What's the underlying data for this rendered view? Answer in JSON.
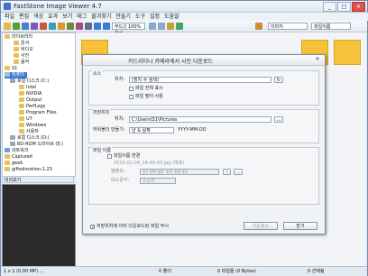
{
  "window": {
    "title": "FastStone Image Viewer 4.7",
    "min": "_",
    "max": "□",
    "close": "✕"
  },
  "menu": [
    "파일",
    "편집",
    "색상",
    "효과",
    "보기",
    "태그",
    "즐겨찾기",
    "만들기",
    "도구",
    "설정",
    "도움말"
  ],
  "toolbar": {
    "zoom": "100%",
    "view_label": "부드럽게",
    "sort_label": "이미지",
    "order_label": "파일이름"
  },
  "tree": [
    {
      "label": "라이브러리"
    },
    {
      "label": "문서"
    },
    {
      "label": "비디오"
    },
    {
      "label": "사진"
    },
    {
      "label": "음악"
    },
    {
      "label": "S1"
    },
    {
      "label": "컴퓨터"
    },
    {
      "label": "로컬 디스크 (C:)"
    },
    {
      "label": "Intel"
    },
    {
      "label": "NVIDIA"
    },
    {
      "label": "Output"
    },
    {
      "label": "PerfLogs"
    },
    {
      "label": "Program Files"
    },
    {
      "label": "U7"
    },
    {
      "label": "Windows"
    },
    {
      "label": "사용자"
    },
    {
      "label": "로컬 디스크 (D:)"
    },
    {
      "label": "BD-ROM 드라이브 (E:)"
    },
    {
      "label": "네트워크"
    },
    {
      "label": "Captureit"
    },
    {
      "label": "geek"
    },
    {
      "label": "giftedmotion-1.23"
    }
  ],
  "preview_label": "미리보기",
  "status": {
    "left": "1 x 1 (0.00 MP) ...",
    "count": "0 폴더",
    "files": "0 파일들 (0 Bytes)",
    "selected": "0 선택됨"
  },
  "dialog": {
    "title": "카드리더나 카메라에서 사진 다운로드",
    "close": "✕",
    "source": {
      "group": "소스",
      "location_label": "위치:",
      "location_value": "(장치 수 검색)",
      "chk_show_all": "파일 전체 표시",
      "chk_include_sub": "파일 필터 사용"
    },
    "dest": {
      "group": "저장위치",
      "folder_label": "위치:",
      "folder_value": "C:\\Users\\S1\\Pictures",
      "subfolder_label": "하위폴더 만들기:",
      "subfolder_value": "년 & 날짜",
      "date_format": "YYYY-MM-DD"
    },
    "rename": {
      "group": "파일 이름",
      "chk_rename": "파일이름 변경",
      "example": "2010-02-04_14-46-00.jpg (예제)",
      "pattern_label": "템플릿:",
      "pattern_value": "$Y-$M-$D_$H-$N-$S",
      "case_label": "대소문자:",
      "case_value": "소문자",
      "btn_q": "?",
      "btn_more": "..."
    },
    "chk_delete": "저장위치에 이미 다운로드된 파일 무시",
    "btn_download": "다운로드",
    "btn_close": "닫기",
    "browse": "..."
  }
}
